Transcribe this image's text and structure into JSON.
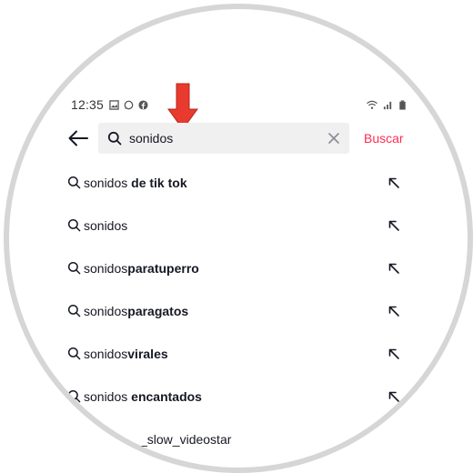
{
  "status_bar": {
    "time": "12:35",
    "left_icons": [
      "image-icon",
      "whatsapp-icon",
      "facebook-icon"
    ],
    "right_icons": [
      "wifi-icon",
      "signal-icon",
      "battery-icon"
    ]
  },
  "search": {
    "value": "sonidos",
    "action_label": "Buscar"
  },
  "suggestions": [
    {
      "typed": "sonidos",
      "rest": " de tik tok"
    },
    {
      "typed": "sonidos",
      "rest": ""
    },
    {
      "typed": "sonidos",
      "rest": "paratuperro"
    },
    {
      "typed": "sonidos",
      "rest": "paragatos"
    },
    {
      "typed": "sonidos",
      "rest": "virales"
    },
    {
      "typed": "sonidos",
      "rest": " encantados"
    }
  ],
  "account_suggestion": {
    "label": "_slow_videostar"
  },
  "colors": {
    "accent": "#fe2c55",
    "indicator_arrow": "#e83a2e",
    "search_bg": "#f0f0f1",
    "frame": "#d6d6d6"
  }
}
